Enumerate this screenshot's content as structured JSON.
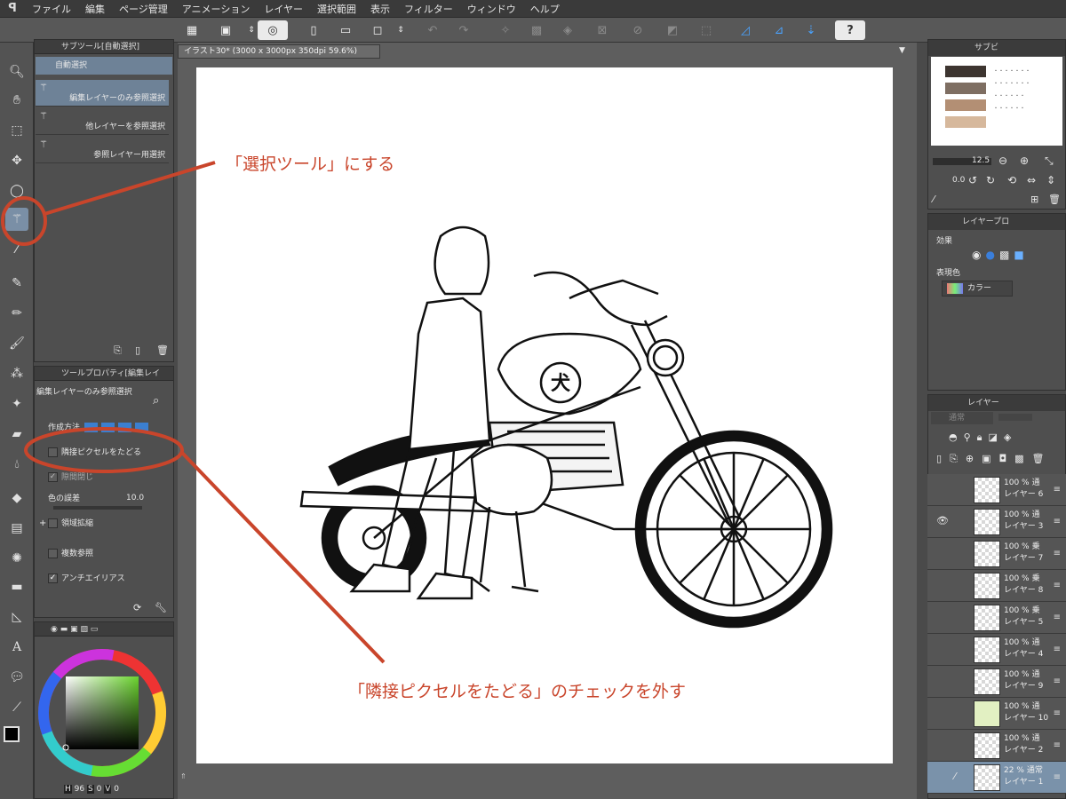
{
  "menu": [
    "ファイル",
    "編集",
    "ページ管理",
    "アニメーション",
    "レイヤー",
    "選択範囲",
    "表示",
    "フィルター",
    "ウィンドウ",
    "ヘルプ"
  ],
  "document_tab": "イラスト30* (3000 x 3000px 350dpi 59.6%)",
  "subtool_panel": {
    "title": "サブツール[自動選択]",
    "group": "自動選択",
    "items": [
      {
        "label": "編集レイヤーのみ参照選択",
        "selected": true
      },
      {
        "label": "他レイヤーを参照選択",
        "selected": false
      },
      {
        "label": "参照レイヤー用選択",
        "selected": false
      }
    ]
  },
  "tool_property": {
    "title": "ツールプロパティ[編集レイ",
    "subtool_name": "編集レイヤーのみ参照選択",
    "mode_label": "作成方法",
    "follow_adjacent": {
      "label": "隣接ピクセルをたどる",
      "checked": false
    },
    "gap_close": {
      "label": "隙間閉じ",
      "checked": true
    },
    "color_margin": {
      "label": "色の誤差",
      "value": "10.0"
    },
    "area_scaling": {
      "label": "領域拡縮",
      "checked": false
    },
    "multi_reference": {
      "label": "複数参照",
      "checked": false
    },
    "antialias": {
      "label": "アンチエイリアス",
      "checked": true
    }
  },
  "color_hsv": {
    "h_label": "H",
    "h": "96",
    "s_label": "S",
    "s": "0",
    "v_label": "V",
    "v": "0"
  },
  "navigator": {
    "tab": "サブビ",
    "zoom": "12.5",
    "angle": "0.0",
    "colors": [
      "#3d3530",
      "#7e6e62",
      "#b38f74",
      "#d6b89c"
    ]
  },
  "layer_property": {
    "tab": "レイヤープロ",
    "effect_label": "効果",
    "expression_label": "表現色",
    "expression_value": "カラー"
  },
  "layers_panel": {
    "tab": "レイヤー",
    "blend": "通常",
    "layers": [
      {
        "opacity": "100 %",
        "blend": "通",
        "name": "レイヤー 6",
        "visible": false,
        "thumb": "pattern"
      },
      {
        "opacity": "100 %",
        "blend": "通",
        "name": "レイヤー 3",
        "visible": true,
        "thumb": "pattern"
      },
      {
        "opacity": "100 %",
        "blend": "乗",
        "name": "レイヤー 7",
        "visible": false,
        "thumb": "pattern"
      },
      {
        "opacity": "100 %",
        "blend": "乗",
        "name": "レイヤー 8",
        "visible": false,
        "thumb": "pattern"
      },
      {
        "opacity": "100 %",
        "blend": "乗",
        "name": "レイヤー 5",
        "visible": false,
        "thumb": "pattern"
      },
      {
        "opacity": "100 %",
        "blend": "通",
        "name": "レイヤー 4",
        "visible": false,
        "thumb": "pattern"
      },
      {
        "opacity": "100 %",
        "blend": "通",
        "name": "レイヤー 9",
        "visible": false,
        "thumb": "pattern"
      },
      {
        "opacity": "100 %",
        "blend": "通",
        "name": "レイヤー 10",
        "visible": false,
        "thumb": "#e2f0c2"
      },
      {
        "opacity": "100 %",
        "blend": "通",
        "name": "レイヤー 2",
        "visible": false,
        "thumb": "pattern"
      },
      {
        "opacity": "22 %",
        "blend": "通常",
        "name": "レイヤー 1",
        "visible": false,
        "thumb": "pattern",
        "selected": true
      }
    ]
  },
  "annotations": {
    "select_tool": "「選択ツール」にする",
    "uncheck": "「隣接ピクセルをたどる」のチェックを外す"
  },
  "artwork": {
    "tank_emblem": "犬"
  },
  "accent_colors": {
    "annotation": "#c9452b",
    "selection": "#6e8297"
  }
}
